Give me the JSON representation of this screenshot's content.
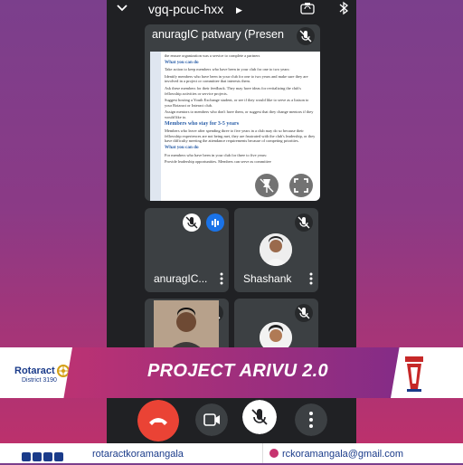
{
  "meet": {
    "code": "vgq-pcuc-hxx",
    "presenter_label": "anuragIC patwary (Presen",
    "document": {
      "top_line": "the ensure organization was a service to complete a partners",
      "h1": "What you can do",
      "p1": "Take action to keep members who have been in your club for one to two years:",
      "b1": "Identify members who have been in your club for one to two years and make sure they are involved in a project or committee that interests them.",
      "b2": "Ask these members for their feedback. They may have ideas for revitalizing the club's fellowship activities or service projects.",
      "b3": "Suggest hosting a Youth Exchange student, or see if they would like to serve as a liaison to your Rotaract or Interact club.",
      "b4": "Assign mentors to members who don't have them, or suggest that they change mentors if they would like to.",
      "h2": "Members who stay for 3-5 years",
      "p2": "Members who leave after spending three to five years in a club may do so because their fellowship experiences are not being met, they are frustrated with the club's leadership, or they have difficulty meeting the attendance requirements because of competing priorities.",
      "h3": "What you can do",
      "p3": "For members who have been in your club for three to five years:",
      "b5": "Provide leadership opportunities. Members can serve as committee"
    },
    "participants": [
      {
        "name": "anuragIC..."
      },
      {
        "name": "Shashank"
      }
    ]
  },
  "banner": {
    "title": "PROJECT ARIVU 2.0",
    "org": "Rotaract",
    "district": "District 3190"
  },
  "footer": {
    "handle": "rotaractkoramangala",
    "email": "rckoramangala@gmail.com"
  },
  "colors": {
    "end_call": "#ea4335",
    "meet_bg": "#202124",
    "tile_bg": "#3c4043",
    "speaking": "#1a73e8",
    "banner_pink": "#c6336f"
  }
}
